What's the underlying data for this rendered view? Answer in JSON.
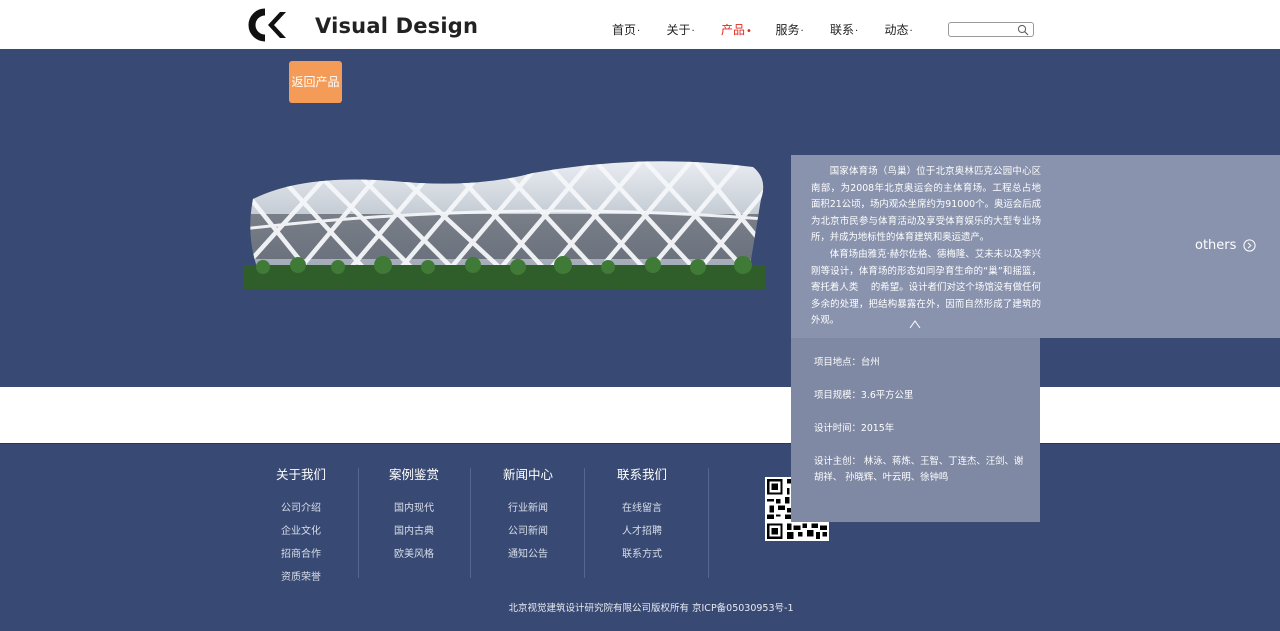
{
  "header": {
    "logo_text": "Visual Design",
    "nav": [
      {
        "label": "首页",
        "dot": "·",
        "active": false
      },
      {
        "label": "关于",
        "dot": "·",
        "active": false
      },
      {
        "label": "产品",
        "dot": "•",
        "active": true
      },
      {
        "label": "服务",
        "dot": "·",
        "active": false
      },
      {
        "label": "联系",
        "dot": "·",
        "active": false
      },
      {
        "label": "动态",
        "dot": "·",
        "active": false
      }
    ],
    "search": {
      "value": "",
      "placeholder": ""
    }
  },
  "banner": {
    "back_label": "返回产品"
  },
  "project": {
    "desc_p1": "国家体育场（鸟巢）位于北京奥林匹克公园中心区南部，为2008年北京奥运会的主体育场。工程总占地面积21公顷，场内观众坐席约为91000个。奥运会后成为北京市民参与体育活动及享受体育娱乐的大型专业场所，并成为地标性的体育建筑和奥运遗产。",
    "desc_p2": "体育场由雅克·赫尔佐格、德梅隆、艾未未以及李兴刚等设计，体育场的形态如同孕育生命的“巢”和摇篮，寄托着人类　 的希望。设计者们对这个场馆没有做任何多余的处理，把结构暴露在外，因而自然形成了建筑的外观。",
    "others_label": "others",
    "location": "项目地点：台州",
    "scale": "项目规模：3.6平方公里",
    "design_time": "设计时间：2015年",
    "designers": "设计主创：  林泳、蒋炼、王智、丁连杰、汪剑、谢胡祥、 孙晓辉、叶云明、徐钟鸣"
  },
  "footer": {
    "columns": [
      {
        "title": "关于我们",
        "links": [
          "公司介绍",
          "企业文化",
          "招商合作",
          "资质荣誉"
        ]
      },
      {
        "title": "案例鉴赏",
        "links": [
          "国内现代",
          "国内古典",
          "欧美风格"
        ]
      },
      {
        "title": "新闻中心",
        "links": [
          "行业新闻",
          "公司新闻",
          "通知公告"
        ]
      },
      {
        "title": "联系我们",
        "links": [
          "在线留言",
          "人才招聘",
          "联系方式"
        ]
      }
    ],
    "copyright": "北京视觉建筑设计研究院有限公司版权所有 京ICP备05030953号-1"
  },
  "colors": {
    "banner_bg": "#384a73",
    "back_button": "#f49c57",
    "nav_active": "#e2261d",
    "panel_bg": "#8993ae",
    "info_bg": "#7f89a4"
  },
  "icons": {
    "search": "search-icon",
    "others_arrow": "arrow-right-circle-icon",
    "caret": "caret-up-icon"
  }
}
